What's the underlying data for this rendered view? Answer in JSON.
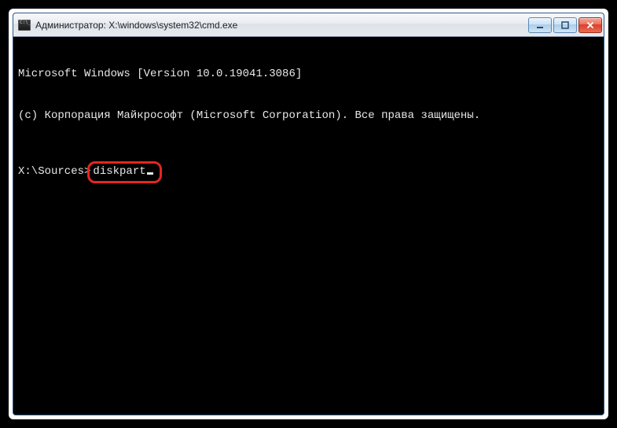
{
  "window": {
    "title": "Администратор: X:\\windows\\system32\\cmd.exe"
  },
  "terminal": {
    "line1": "Microsoft Windows [Version 10.0.19041.3086]",
    "line2": "(c) Корпорация Майкрософт (Microsoft Corporation). Все права защищены.",
    "prompt": "X:\\Sources>",
    "command": "diskpart"
  }
}
